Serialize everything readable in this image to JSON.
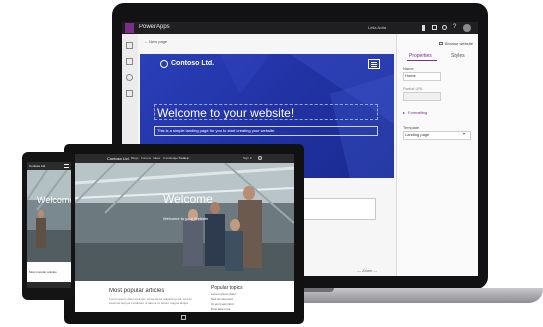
{
  "laptop": {
    "app_title": "PowerApps",
    "user_name": "Leila Avila",
    "toolbar_crumb": "← New page",
    "site": {
      "logo_text": "Contoso Ltd.",
      "hero_title": "Welcome to your website!",
      "hero_subtitle": "This is a simple landing page for you to start creating your website."
    },
    "panel": {
      "browse_link": "Browse website",
      "tab_properties": "Properties",
      "tab_style": "Styles",
      "name_label": "Name",
      "name_value": "Home",
      "url_label": "Partial URL",
      "formatting_label": "Formatting",
      "template_label": "Template",
      "template_value": "Landing page"
    },
    "zoom_label": "— Zoom —"
  },
  "tablet": {
    "site_name": "Contoso Ltd.",
    "nav": [
      "Blogs",
      "Forums",
      "Ideas",
      "Knowledge Base",
      "Help"
    ],
    "sign_in": "Sign in",
    "hero_title": "Welcome",
    "hero_subtitle": "Welcome to your Website",
    "articles_title": "Most popular articles",
    "articles_text": "Lorem ipsum dolor sit amet, consectetur adipiscing elit, sed do eiusmod tempor incididunt ut labore et dolore magna aliqua.",
    "topics_title": "Popular topics",
    "topics": [
      "Lorem ipsum dolor",
      "Sed do eiusmod",
      "Ut enim ad minim",
      "Duis aute irure"
    ]
  },
  "phone": {
    "site_name": "Contoso Ltd.",
    "hero_title": "Welcome",
    "articles_title": "Most popular articles"
  }
}
